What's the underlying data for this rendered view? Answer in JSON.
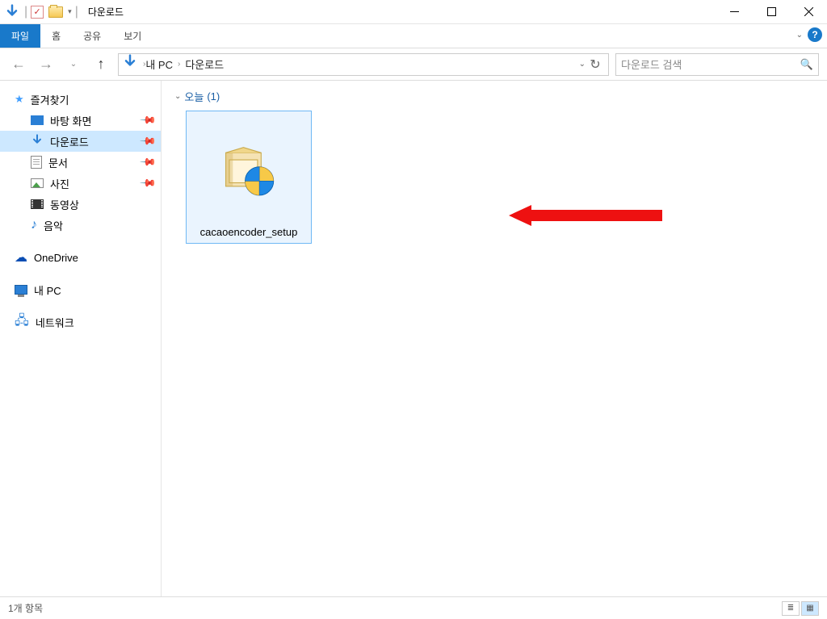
{
  "window": {
    "title": "다운로드"
  },
  "ribbon": {
    "file": "파일",
    "tabs": [
      "홈",
      "공유",
      "보기"
    ]
  },
  "breadcrumb": {
    "parts": [
      "내 PC",
      "다운로드"
    ]
  },
  "search": {
    "placeholder": "다운로드 검색"
  },
  "sidebar": {
    "quick": {
      "label": "즐겨찾기"
    },
    "items": [
      {
        "label": "바탕 화면",
        "pinned": true
      },
      {
        "label": "다운로드",
        "pinned": true,
        "active": true
      },
      {
        "label": "문서",
        "pinned": true
      },
      {
        "label": "사진",
        "pinned": true
      },
      {
        "label": "동영상",
        "pinned": false
      },
      {
        "label": "음악",
        "pinned": false
      }
    ],
    "onedrive": "OneDrive",
    "thispc": "내 PC",
    "network": "네트워크"
  },
  "content": {
    "group_name": "오늘",
    "group_count": "1",
    "files": [
      {
        "name": "cacaoencoder_setup"
      }
    ]
  },
  "status": {
    "item_count": "1개 항목"
  }
}
